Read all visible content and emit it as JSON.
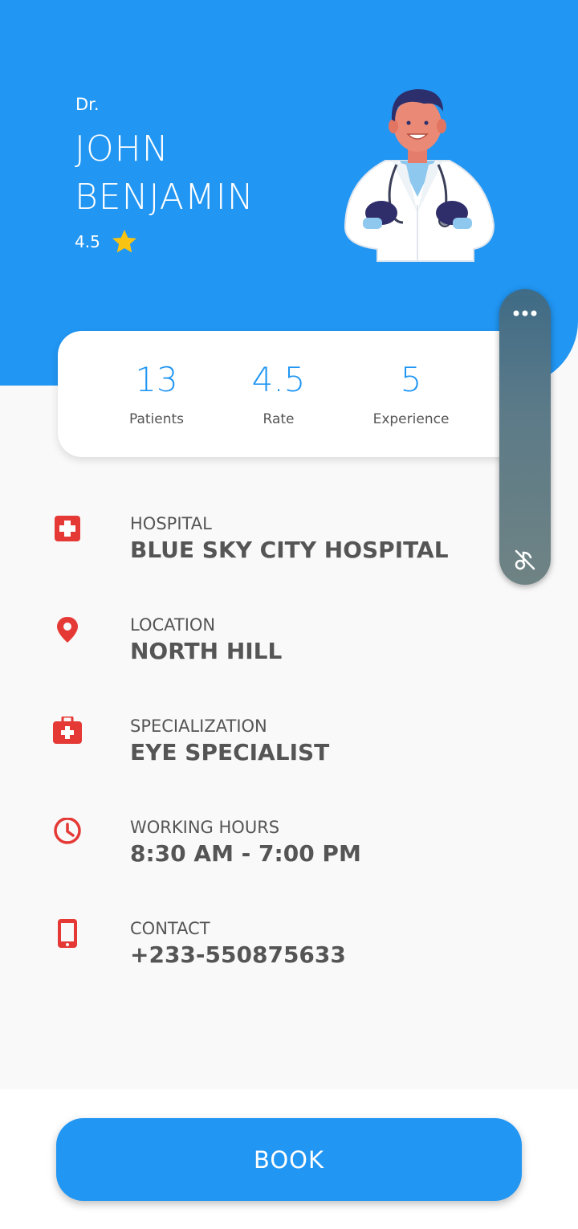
{
  "doctor": {
    "prefix": "Dr.",
    "first_name": "JOHN",
    "last_name": "BENJAMIN",
    "rating": "4.5",
    "star_icon": "star-icon"
  },
  "stats": [
    {
      "value": "13",
      "label": "Patients"
    },
    {
      "value": "4.5",
      "label": "Rate"
    },
    {
      "value": "5",
      "label": "Experience"
    }
  ],
  "info": [
    {
      "icon": "hospital-icon",
      "label": "HOSPITAL",
      "value": "BLUE SKY CITY HOSPITAL"
    },
    {
      "icon": "location-pin-icon",
      "label": "LOCATION",
      "value": "NORTH HILL"
    },
    {
      "icon": "medical-kit-icon",
      "label": "SPECIALIZATION",
      "value": "EYE SPECIALIST"
    },
    {
      "icon": "clock-icon",
      "label": "WORKING HOURS",
      "value": "8:30 AM - 7:00 PM"
    },
    {
      "icon": "phone-icon",
      "label": "CONTACT",
      "value": "+233-550875633"
    }
  ],
  "book_button": "BOOK",
  "colors": {
    "primary": "#2196F3",
    "icon_red": "#E53935",
    "text_gray": "#555555",
    "star": "#F9C313"
  }
}
